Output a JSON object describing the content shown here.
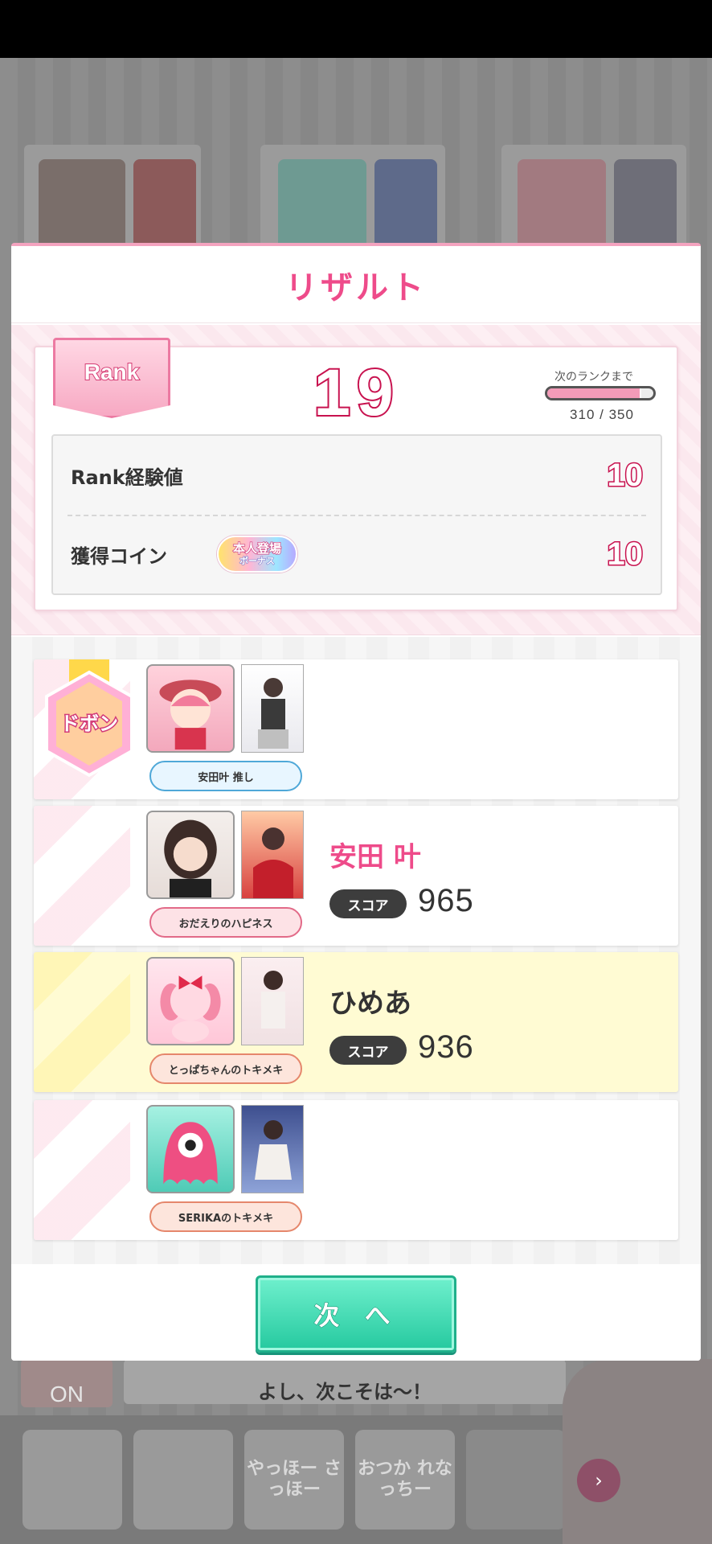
{
  "modal": {
    "title": "リザルト",
    "next_button": "次 へ"
  },
  "rank": {
    "badge": "Rank",
    "level": "19",
    "next_label": "次のランクまで",
    "progress_text": "310 / 350",
    "progress_current": 310,
    "progress_max": 350,
    "rows": [
      {
        "label": "Rank経験値",
        "value": "10"
      },
      {
        "label": "獲得コイン",
        "value": "10"
      }
    ],
    "bonus_line1": "本人登場",
    "bonus_line2": "ボーナス"
  },
  "results": {
    "medal_text": "ドボン",
    "players": [
      {
        "skill": "安田叶 推し",
        "name": "",
        "score_label": "",
        "score": ""
      },
      {
        "skill": "おだえりのハピネス",
        "name": "安田 叶",
        "score_label": "スコア",
        "score": "965"
      },
      {
        "skill": "とっぱちゃんのトキメキ",
        "name": "ひめあ",
        "score_label": "スコア",
        "score": "936"
      },
      {
        "skill": "SERIKAのトキメキ",
        "name": "",
        "score_label": "",
        "score": ""
      }
    ]
  },
  "background": {
    "toggle_label": "ON",
    "message": "よし、次こそは～！",
    "stamps": [
      "",
      "",
      "やっほー さっほー",
      "おつか れなっちー"
    ]
  },
  "colors": {
    "accent_pink": "#ee4b8a",
    "rank_number_stroke": "#c8124f",
    "next_button": "#25c99f",
    "highlight_row": "#fffbd3"
  }
}
